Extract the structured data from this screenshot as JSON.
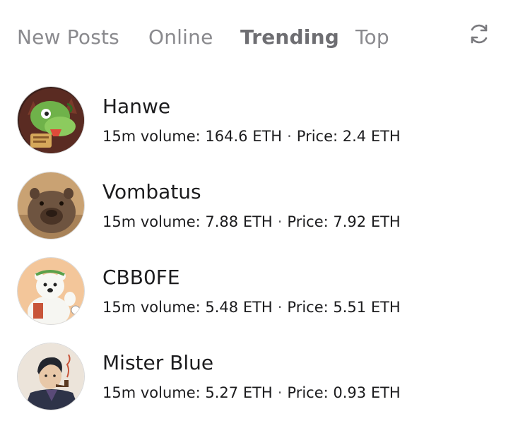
{
  "tabs": [
    {
      "label": "New Posts",
      "active": false
    },
    {
      "label": "Online",
      "active": false
    },
    {
      "label": "Trending",
      "active": true
    },
    {
      "label": "Top",
      "active": false
    }
  ],
  "refresh_icon": "refresh-icon",
  "separator": "·",
  "items": [
    {
      "name": "Hanwe",
      "volume_text": "15m volume: 164.6 ETH",
      "price_text": "Price: 2.4 ETH",
      "avatar_icon": "dragon-avatar"
    },
    {
      "name": "Vombatus",
      "volume_text": "15m volume: 7.88 ETH",
      "price_text": "Price: 7.92 ETH",
      "avatar_icon": "wombat-avatar"
    },
    {
      "name": "CBB0FE",
      "volume_text": "15m volume: 5.48 ETH",
      "price_text": "Price: 5.51 ETH",
      "avatar_icon": "polar-bear-avatar"
    },
    {
      "name": "Mister Blue",
      "volume_text": "15m volume: 5.27 ETH",
      "price_text": "Price: 0.93 ETH",
      "avatar_icon": "man-with-pipe-avatar"
    }
  ],
  "colors": {
    "text": "#1c1c1e",
    "tab_inactive": "#8a8a8e",
    "tab_active": "#6e6e72",
    "icon": "#7a7a7e"
  }
}
